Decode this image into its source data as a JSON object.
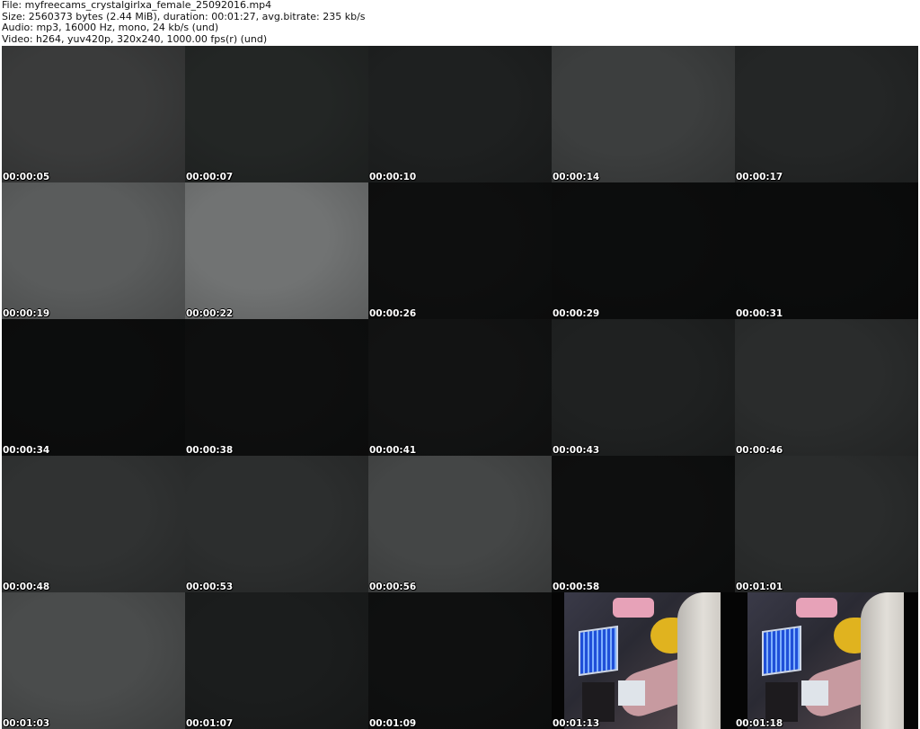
{
  "header": {
    "file_line": "File: myfreecams_crystalgirlxa_female_25092016.mp4",
    "size_line": "Size: 2560373 bytes (2.44 MiB), duration: 00:01:27, avg.bitrate: 235 kb/s",
    "audio_line": "Audio: mp3, 16000 Hz, mono, 24 kb/s (und)",
    "video_line": "Video: h264, yuv420p, 320x240, 1000.00 fps(r) (und)"
  },
  "thumbnails": [
    {
      "time": "00:00:05",
      "tone": "#3a3b3b"
    },
    {
      "time": "00:00:07",
      "tone": "#232625"
    },
    {
      "time": "00:00:10",
      "tone": "#1e2020"
    },
    {
      "time": "00:00:14",
      "tone": "#3c3e3e"
    },
    {
      "time": "00:00:17",
      "tone": "#242626"
    },
    {
      "time": "00:00:19",
      "tone": "#5a5c5c"
    },
    {
      "time": "00:00:22",
      "tone": "#717373"
    },
    {
      "time": "00:00:26",
      "tone": "#0e0f0f"
    },
    {
      "time": "00:00:29",
      "tone": "#0c0d0d"
    },
    {
      "time": "00:00:31",
      "tone": "#0b0c0c"
    },
    {
      "time": "00:00:34",
      "tone": "#0c0d0d"
    },
    {
      "time": "00:00:38",
      "tone": "#0e0f0f"
    },
    {
      "time": "00:00:41",
      "tone": "#121313"
    },
    {
      "time": "00:00:43",
      "tone": "#1f2121"
    },
    {
      "time": "00:00:46",
      "tone": "#2a2c2c"
    },
    {
      "time": "00:00:48",
      "tone": "#303232"
    },
    {
      "time": "00:00:53",
      "tone": "#2c2e2e"
    },
    {
      "time": "00:00:56",
      "tone": "#444646"
    },
    {
      "time": "00:00:58",
      "tone": "#0e0f0f"
    },
    {
      "time": "00:01:01",
      "tone": "#2a2c2c"
    },
    {
      "time": "00:01:03",
      "tone": "#4a4c4c"
    },
    {
      "time": "00:01:07",
      "tone": "#1b1d1d"
    },
    {
      "time": "00:01:09",
      "tone": "#0f1010"
    },
    {
      "time": "00:01:13",
      "tone": "scene"
    },
    {
      "time": "00:01:18",
      "tone": "scene"
    }
  ]
}
